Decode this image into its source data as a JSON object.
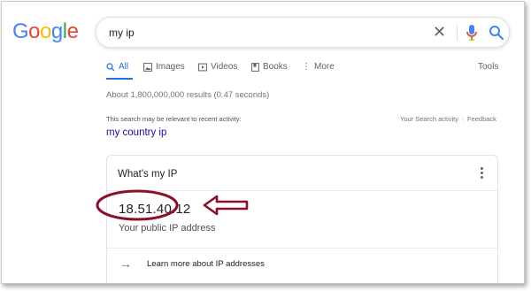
{
  "logo": {
    "text": "Google",
    "letters": [
      {
        "ch": "G",
        "color": "#4285f4"
      },
      {
        "ch": "o",
        "color": "#ea4335"
      },
      {
        "ch": "o",
        "color": "#fbbc05"
      },
      {
        "ch": "g",
        "color": "#4285f4"
      },
      {
        "ch": "l",
        "color": "#34a853"
      },
      {
        "ch": "e",
        "color": "#ea4335"
      }
    ]
  },
  "search": {
    "query": "my ip"
  },
  "tabs": [
    {
      "label": "All",
      "icon": "search-icon",
      "active": true
    },
    {
      "label": "Images",
      "icon": "image-icon"
    },
    {
      "label": "Videos",
      "icon": "video-icon"
    },
    {
      "label": "Books",
      "icon": "book-icon"
    },
    {
      "label": "More",
      "icon": "more-vert-icon"
    }
  ],
  "tools_label": "Tools",
  "stats": "About 1,800,000,000 results (0.47 seconds)",
  "recent": {
    "notice": "This search may be relevant to recent activity:",
    "activity_link": "Your Search activity",
    "feedback_link": "Feedback",
    "suggestion": "my country ip"
  },
  "card": {
    "title": "What's my IP",
    "ip": "18.51.40.12",
    "subtitle": "Your public IP address",
    "learn_more": "Learn more about IP addresses"
  },
  "colors": {
    "annotation": "#8b0f2a",
    "link": "#1a0dab",
    "accent": "#1a73e8"
  }
}
